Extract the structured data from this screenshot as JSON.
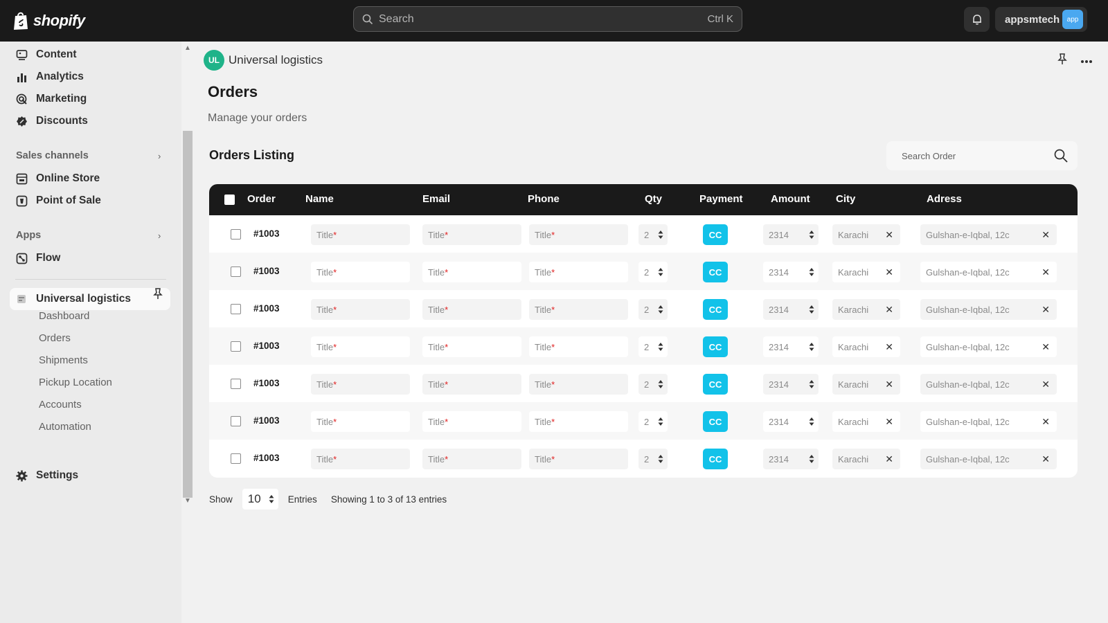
{
  "topbar": {
    "brand": "shopify",
    "search_placeholder": "Search",
    "search_shortcut": "Ctrl K",
    "account_name": "appsmtech",
    "account_badge": "app"
  },
  "sidebar": {
    "top_items": [
      {
        "label": "Content",
        "icon": "content-icon"
      },
      {
        "label": "Analytics",
        "icon": "analytics-icon"
      },
      {
        "label": "Marketing",
        "icon": "marketing-icon"
      },
      {
        "label": "Discounts",
        "icon": "discount-icon"
      }
    ],
    "sales_channels_label": "Sales channels",
    "sales_channels": [
      {
        "label": "Online Store",
        "icon": "online-store-icon"
      },
      {
        "label": "Point of Sale",
        "icon": "pos-icon"
      }
    ],
    "apps_label": "Apps",
    "apps": [
      {
        "label": "Flow",
        "icon": "flow-icon"
      }
    ],
    "active_app": "Universal logistics",
    "active_app_subitems": [
      "Dashboard",
      "Orders",
      "Shipments",
      "Pickup Location",
      "Accounts",
      "Automation"
    ],
    "settings_label": "Settings"
  },
  "main": {
    "app_initials": "UL",
    "app_name": "Universal logistics",
    "page_title": "Orders",
    "page_subtitle": "Manage your orders",
    "listing_title": "Orders Listing",
    "search_placeholder": "Search Order",
    "columns": [
      "Order",
      "Name",
      "Email",
      "Phone",
      "Qty",
      "Payment",
      "Amount",
      "City",
      "Adress"
    ],
    "rows": [
      {
        "order": "#1003",
        "name": "Title",
        "email": "Title",
        "phone": "Title",
        "qty": "2",
        "payment": "CC",
        "amount": "2314",
        "city": "Karachi",
        "address": "Gulshan-e-Iqbal, 12c"
      },
      {
        "order": "#1003",
        "name": "Title",
        "email": "Title",
        "phone": "Title",
        "qty": "2",
        "payment": "CC",
        "amount": "2314",
        "city": "Karachi",
        "address": "Gulshan-e-Iqbal, 12c"
      },
      {
        "order": "#1003",
        "name": "Title",
        "email": "Title",
        "phone": "Title",
        "qty": "2",
        "payment": "CC",
        "amount": "2314",
        "city": "Karachi",
        "address": "Gulshan-e-Iqbal, 12c"
      },
      {
        "order": "#1003",
        "name": "Title",
        "email": "Title",
        "phone": "Title",
        "qty": "2",
        "payment": "CC",
        "amount": "2314",
        "city": "Karachi",
        "address": "Gulshan-e-Iqbal, 12c"
      },
      {
        "order": "#1003",
        "name": "Title",
        "email": "Title",
        "phone": "Title",
        "qty": "2",
        "payment": "CC",
        "amount": "2314",
        "city": "Karachi",
        "address": "Gulshan-e-Iqbal, 12c"
      },
      {
        "order": "#1003",
        "name": "Title",
        "email": "Title",
        "phone": "Title",
        "qty": "2",
        "payment": "CC",
        "amount": "2314",
        "city": "Karachi",
        "address": "Gulshan-e-Iqbal, 12c"
      },
      {
        "order": "#1003",
        "name": "Title",
        "email": "Title",
        "phone": "Title",
        "qty": "2",
        "payment": "CC",
        "amount": "2314",
        "city": "Karachi",
        "address": "Gulshan-e-Iqbal, 12c"
      }
    ],
    "required_marker": "*",
    "footer": {
      "show_label": "Show",
      "page_size": "10",
      "entries_label": "Entries",
      "summary": "Showing 1 to 3 of 13 entries"
    }
  },
  "colors": {
    "topbar_bg": "#1a1a1a",
    "table_header_bg": "#1a1a1a",
    "payment_badge": "#12c2e9",
    "app_avatar": "#1fb389",
    "required": "#e02020"
  }
}
